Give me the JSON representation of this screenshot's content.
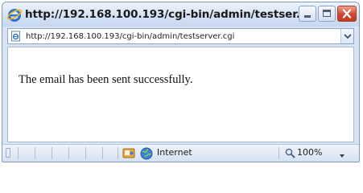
{
  "window": {
    "title": "http://192.168.100.193/cgi-bin/admin/testser...",
    "icon": "internet-explorer-icon",
    "controls": {
      "minimize": "minimize-icon",
      "maximize": "maximize-icon",
      "close": "close-icon"
    }
  },
  "address_bar": {
    "url": "http://192.168.100.193/cgi-bin/admin/testserver.cgi",
    "page_icon": "page-icon",
    "dropdown_icon": "chevron-down-icon"
  },
  "content": {
    "message": "The email has been sent successfully."
  },
  "status_bar": {
    "protected_mode_icon": "protected-mode-icon",
    "zone_icon": "globe-icon",
    "zone_label": "Internet",
    "zoom_icon": "magnifier-icon",
    "zoom_label": "100%",
    "zoom_dropdown_icon": "chevron-down-icon"
  },
  "colors": {
    "title_bar": "#d3e1f4",
    "close_button": "#d1462c",
    "content_background": "#ffffff"
  }
}
